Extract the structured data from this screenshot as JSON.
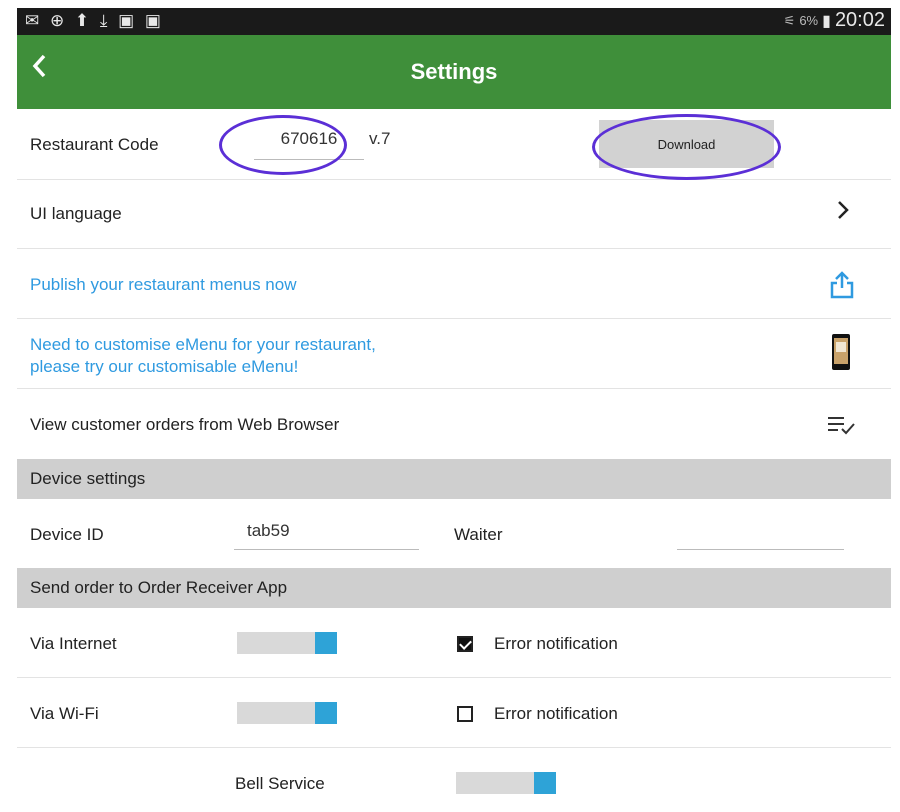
{
  "status": {
    "left_icons": "✉ ⊕ ⬆ ⤓ ▣ ▣",
    "battery": "6%",
    "time": "20:02"
  },
  "appbar": {
    "back_icon": "chevron-left-icon",
    "title": "Settings"
  },
  "restaurant": {
    "label": "Restaurant Code",
    "code": "670616",
    "version": "v.7",
    "download_label": "Download"
  },
  "ui_language": {
    "label": "UI language"
  },
  "publish": {
    "label": "Publish your restaurant menus now"
  },
  "customise": {
    "line1": "Need to customise eMenu for your restaurant,",
    "line2": "please try our customisable eMenu!"
  },
  "view_orders": {
    "label": "View customer orders from Web Browser"
  },
  "device_settings": {
    "header": "Device settings",
    "device_id_label": "Device ID",
    "device_id_value": "tab59",
    "waiter_label": "Waiter",
    "waiter_value": ""
  },
  "send_order": {
    "header": "Send order to Order Receiver App",
    "via_internet_label": "Via Internet",
    "via_internet_on": true,
    "internet_error_label": "Error notification",
    "internet_error_checked": true,
    "via_wifi_label": "Via Wi-Fi",
    "via_wifi_on": true,
    "wifi_error_label": "Error notification",
    "wifi_error_checked": false,
    "bell_label": "Bell Service",
    "bell_on": true
  },
  "colors": {
    "appbar": "#3f8f3a",
    "link": "#2f9ae0",
    "toggle_on": "#2ea3d7",
    "highlight": "#5b2fd6"
  }
}
